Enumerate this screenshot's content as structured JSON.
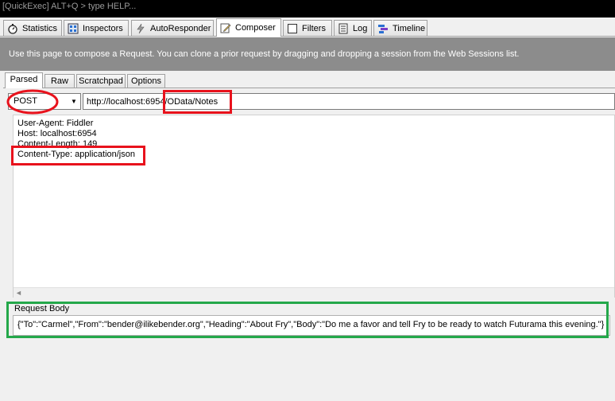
{
  "quickexec": {
    "text": "[QuickExec] ALT+Q > type HELP..."
  },
  "tabs": [
    {
      "label": "Statistics",
      "icon": "stopwatch-icon"
    },
    {
      "label": "Inspectors",
      "icon": "inspectors-icon"
    },
    {
      "label": "AutoResponder",
      "icon": "lightning-icon"
    },
    {
      "label": "Composer",
      "icon": "pencil-icon",
      "active": true
    },
    {
      "label": "Filters",
      "icon": "checkbox-icon"
    },
    {
      "label": "Log",
      "icon": "log-icon"
    },
    {
      "label": "Timeline",
      "icon": "timeline-icon"
    }
  ],
  "banner": {
    "text": "Use this page to compose a Request. You can clone a prior request by dragging and dropping a session from the Web Sessions list."
  },
  "subtabs": [
    {
      "label": "Parsed",
      "active": true
    },
    {
      "label": "Raw"
    },
    {
      "label": "Scratchpad"
    },
    {
      "label": "Options"
    }
  ],
  "request": {
    "method": "POST",
    "url": "http://localhost:6954/OData/Notes"
  },
  "headers": [
    "User-Agent: Fiddler",
    "Host: localhost:6954",
    "Content-Length: 149",
    "Content-Type: application/json"
  ],
  "body": {
    "label": "Request Body",
    "text": "{\"To\":\"Carmel\",\"From\":\"bender@ilikebender.org\",\"Heading\":\"About Fry\",\"Body\":\"Do me a favor and tell Fry to be ready to watch Futurama this evening.\"}"
  },
  "colors": {
    "annotation_red": "#e8121c",
    "annotation_green": "#24a84a",
    "banner_bg": "#8c8c8c"
  }
}
